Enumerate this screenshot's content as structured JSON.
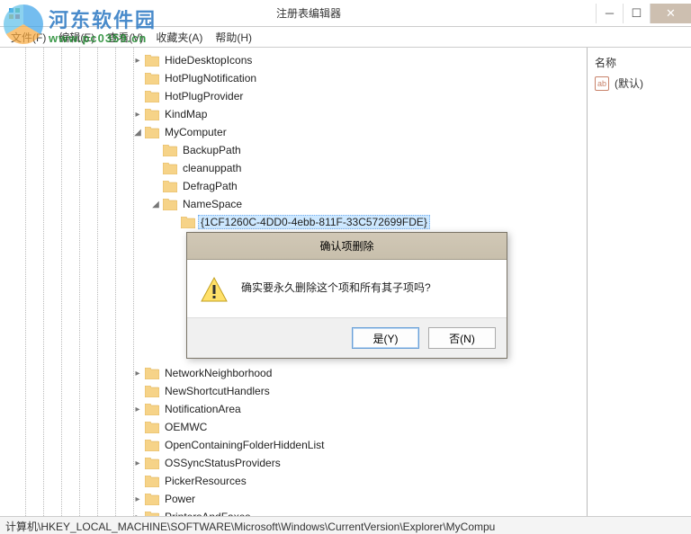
{
  "window": {
    "title": "注册表编辑器"
  },
  "menu": {
    "file": "文件(F)",
    "edit": "编辑(E)",
    "view": "查看(V)",
    "favorites": "收藏夹(A)",
    "help": "帮助(H)"
  },
  "tree": {
    "items": [
      "HideDesktopIcons",
      "HotPlugNotification",
      "HotPlugProvider",
      "KindMap",
      "MyComputer",
      "BackupPath",
      "cleanuppath",
      "DefragPath",
      "NameSpace",
      "{1CF1260C-4DD0-4ebb-811F-33C572699FDE}",
      "NetworkNeighborhood",
      "NewShortcutHandlers",
      "NotificationArea",
      "OEMWC",
      "OpenContainingFolderHiddenList",
      "OSSyncStatusProviders",
      "PickerResources",
      "Power",
      "PrintersAndFaxes"
    ]
  },
  "rightpane": {
    "header": "名称",
    "default_label": "(默认)"
  },
  "dialog": {
    "title": "确认项删除",
    "message": "确实要永久删除这个项和所有其子项吗?",
    "yes": "是(Y)",
    "no": "否(N)"
  },
  "statusbar": {
    "path": "计算机\\HKEY_LOCAL_MACHINE\\SOFTWARE\\Microsoft\\Windows\\CurrentVersion\\Explorer\\MyCompu"
  },
  "watermark": {
    "line1": "河东软件园",
    "line2": "www.pc0359.cn"
  }
}
